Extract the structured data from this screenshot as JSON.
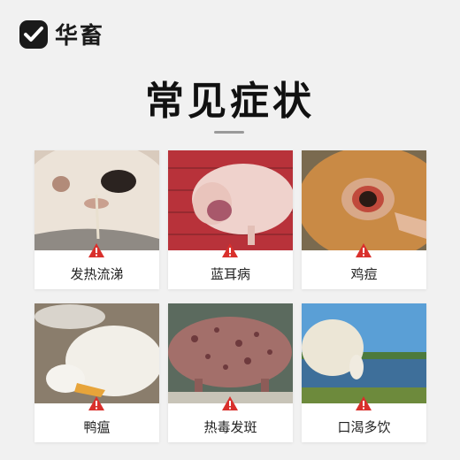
{
  "brand": {
    "name": "华畜",
    "logo_icon": "check-shield-icon"
  },
  "title": "常见症状",
  "accent_color": "#d9302c",
  "symptoms": [
    {
      "label": "发热流涕",
      "image": "cow-nose-photo",
      "badge_icon": "warning-icon"
    },
    {
      "label": "蓝耳病",
      "image": "pig-photo",
      "badge_icon": "warning-icon"
    },
    {
      "label": "鸡痘",
      "image": "chicken-eye-photo",
      "badge_icon": "warning-icon"
    },
    {
      "label": "鸭瘟",
      "image": "duck-photo",
      "badge_icon": "warning-icon"
    },
    {
      "label": "热毒发斑",
      "image": "spotted-pig-photo",
      "badge_icon": "warning-icon"
    },
    {
      "label": "口渴多饮",
      "image": "sheep-drinking-photo",
      "badge_icon": "warning-icon"
    }
  ]
}
